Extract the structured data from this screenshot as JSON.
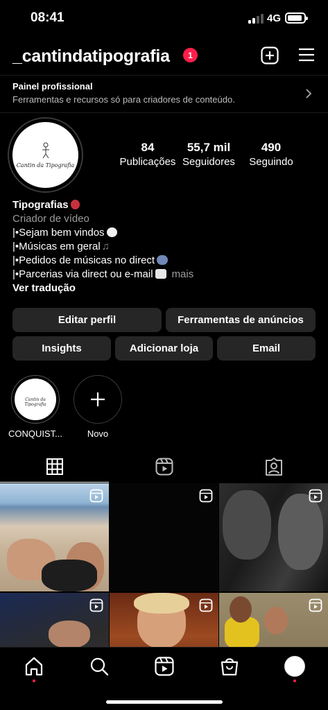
{
  "status_bar": {
    "time": "08:41",
    "network": "4G",
    "icons": [
      "signal-icon",
      "battery-icon"
    ]
  },
  "header": {
    "username": "_cantindatipografia",
    "notification_count": "1",
    "icons": [
      "create-post-icon",
      "menu-icon"
    ]
  },
  "pro_panel": {
    "title": "Painel profissional",
    "subtitle": "Ferramentas e recursos só para criadores de conteúdo."
  },
  "profile": {
    "avatar_text": "Cantin da Tipografia",
    "stats": [
      {
        "value": "84",
        "label": "Publicações"
      },
      {
        "value": "55,7 mil",
        "label": "Seguidores"
      },
      {
        "value": "490",
        "label": "Seguindo"
      }
    ],
    "bio": {
      "name": "Tipografias",
      "category": "Criador de vídeo",
      "lines": [
        "|•Sejam bem vindos",
        "|•Músicas em geral",
        "|•Pedidos de músicas no direct",
        "|•Parcerias via direct ou e-mail"
      ],
      "more": "mais",
      "translate": "Ver tradução"
    }
  },
  "actions": {
    "edit_profile": "Editar perfil",
    "ad_tools": "Ferramentas de anúncios",
    "insights": "Insights",
    "add_shop": "Adicionar loja",
    "email": "Email"
  },
  "highlights": [
    {
      "label": "CONQUIST..."
    },
    {
      "label": "Novo"
    }
  ],
  "tabs": [
    "grid-icon",
    "reels-icon",
    "tagged-icon"
  ],
  "bottom_nav": [
    "home-icon",
    "search-icon",
    "reels-icon",
    "shop-icon",
    "profile-avatar"
  ],
  "colors": {
    "background": "#000000",
    "button": "#262626",
    "badge": "#ff1f4b",
    "muted_text": "#9c9c9c"
  }
}
